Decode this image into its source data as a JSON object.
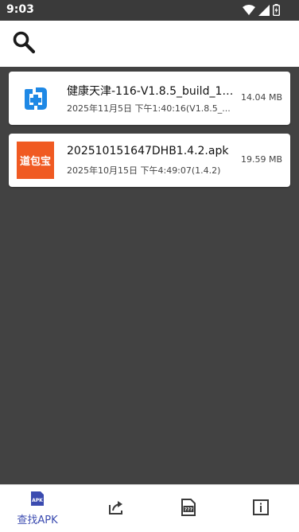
{
  "status_bar": {
    "time": "9:03",
    "icons": [
      "wifi-icon",
      "signal-icon",
      "battery-charging-icon"
    ]
  },
  "toolbar": {
    "search_icon": "search-icon"
  },
  "apk_list": [
    {
      "icon": "jiankang-tianjin-app-icon",
      "name": "健康天津-116-V1.8.5_build_11...",
      "meta": "2025年11月5日 下午1:40:16(V1.8.5_...",
      "size": "14.04 MB"
    },
    {
      "icon": "daobao-app-icon",
      "icon_text": "道包宝",
      "name": "202510151647DHB1.4.2.apk",
      "meta": "2025年10月15日 下午4:49:07(1.4.2)",
      "size": "19.59 MB"
    }
  ],
  "bottom_nav": {
    "items": [
      {
        "icon": "apk-icon",
        "icon_text": "APK",
        "label": "查找APK",
        "active": true
      },
      {
        "icon": "share-icon",
        "label": ""
      },
      {
        "icon": "unknown-file-icon",
        "icon_text": "???",
        "label": ""
      },
      {
        "icon": "info-icon",
        "label": ""
      }
    ]
  },
  "colors": {
    "background": "#424242",
    "accent": "#3b4bb0",
    "daobao_orange": "#f05a22",
    "jiankang_blue": "#1e88e5"
  }
}
